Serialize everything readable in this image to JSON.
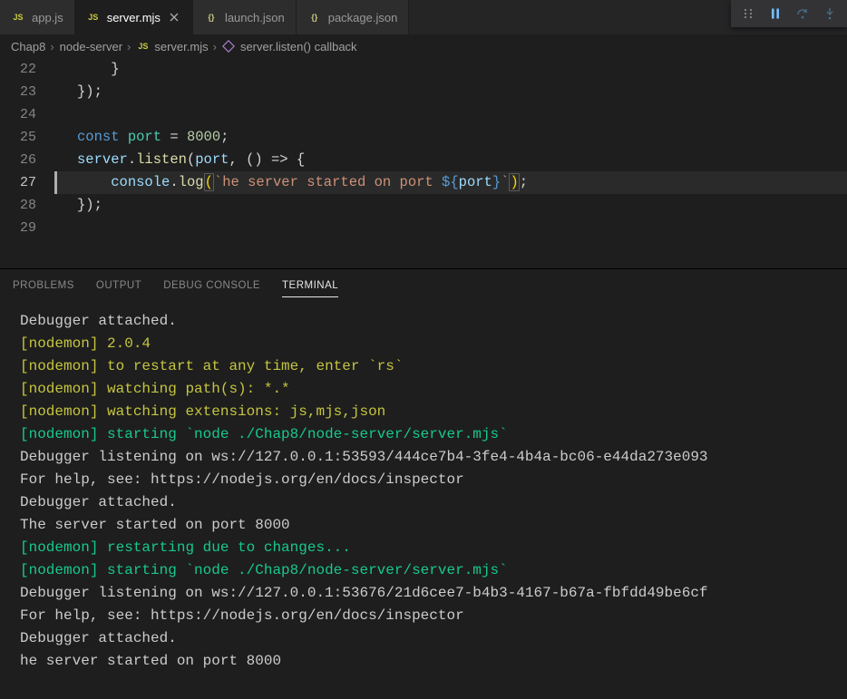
{
  "tabs": [
    {
      "label": "app.js",
      "icon": "JS",
      "iconClass": "ext-js"
    },
    {
      "label": "server.mjs",
      "icon": "JS",
      "iconClass": "ext-js",
      "active": true
    },
    {
      "label": "launch.json",
      "icon": "{}",
      "iconClass": "ext-json"
    },
    {
      "label": "package.json",
      "icon": "{}",
      "iconClass": "ext-json"
    }
  ],
  "breadcrumbs": {
    "c1": "Chap8",
    "c2": "node-server",
    "c3": "server.mjs",
    "c3icon": "JS",
    "c4": "server.listen() callback"
  },
  "gutter": {
    "l22": "22",
    "l23": "23",
    "l24": "24",
    "l25": "25",
    "l26": "26",
    "l27": "27",
    "l28": "28",
    "l29": "29"
  },
  "code": {
    "l22": "    }",
    "l23": "});",
    "l25_const": "const",
    "l25_port": "port",
    "l25_eq": " = ",
    "l25_num": "8000",
    "l25_semi": ";",
    "l26_server": "server",
    "l26_dot": ".",
    "l26_listen": "listen",
    "l26_lp": "(",
    "l26_port": "port",
    "l26_comma": ", ",
    "l26_arrow": "() => {",
    "l27_pad": "    ",
    "l27_console": "console",
    "l27_dot": ".",
    "l27_log": "log",
    "l27_lp": "(",
    "l27_bt1": "`",
    "l27_str": "he server started on port ",
    "l27_dl": "${",
    "l27_var": "port",
    "l27_dr": "}",
    "l27_bt2": "`",
    "l27_rp": ")",
    "l27_semi": ";",
    "l28": "});",
    "l2x_blank": ""
  },
  "panel": {
    "tabs": {
      "problems": "PROBLEMS",
      "output": "OUTPUT",
      "debug": "DEBUG CONSOLE",
      "terminal": "TERMINAL"
    }
  },
  "terminal": {
    "l1": "Debugger attached.",
    "l2a": "[nodemon]",
    "l2b": " 2.0.4",
    "l3a": "[nodemon]",
    "l3b": " to restart at any time, enter `rs`",
    "l4a": "[nodemon]",
    "l4b": " watching path(s): *.*",
    "l5a": "[nodemon]",
    "l5b": " watching extensions: js,mjs,json",
    "l6a": "[nodemon]",
    "l6b": " starting `node ./Chap8/node-server/server.mjs`",
    "l7": "Debugger listening on ws://127.0.0.1:53593/444ce7b4-3fe4-4b4a-bc06-e44da273e093",
    "l8": "For help, see: https://nodejs.org/en/docs/inspector",
    "l9": "Debugger attached.",
    "l10": "The server started on port 8000",
    "l11a": "[nodemon]",
    "l11b": " restarting due to changes...",
    "l12a": "[nodemon]",
    "l12b": " starting `node ./Chap8/node-server/server.mjs`",
    "l13": "Debugger listening on ws://127.0.0.1:53676/21d6cee7-b4b3-4167-b67a-fbfdd49be6cf",
    "l14": "For help, see: https://nodejs.org/en/docs/inspector",
    "l15": "Debugger attached.",
    "l16": "he server started on port 8000"
  }
}
